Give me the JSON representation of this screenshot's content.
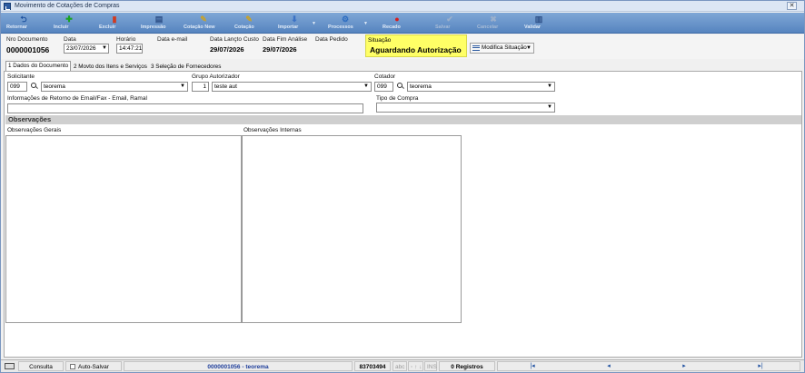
{
  "window": {
    "title": "Movimento de Cotações de Compras",
    "close_label": "✕"
  },
  "toolbar": {
    "buttons": [
      {
        "label": "Retornar",
        "icon": "return-icon",
        "glyph": "⮌",
        "color": "#1b4f9c"
      },
      {
        "label": "Incluir",
        "icon": "plus-icon",
        "glyph": "✚",
        "color": "#1aa321"
      },
      {
        "label": "Excluir",
        "icon": "delete-icon",
        "glyph": "▮",
        "color": "#d13a1f"
      },
      {
        "label": "Impressão",
        "icon": "printer-icon",
        "glyph": "▤",
        "color": "#2d4f86"
      },
      {
        "label": "Cotação New",
        "icon": "quote-new-icon",
        "glyph": "✎",
        "color": "#c9a227"
      },
      {
        "label": "Cotação",
        "icon": "quote-icon",
        "glyph": "✎",
        "color": "#c9a227"
      },
      {
        "label": "Importar",
        "icon": "import-icon",
        "glyph": "⬇",
        "color": "#3c72c4"
      },
      {
        "label": "Processos",
        "icon": "process-icon",
        "glyph": "⚙",
        "color": "#2a6bc0"
      },
      {
        "label": "Recado",
        "icon": "message-icon",
        "glyph": "●",
        "color": "#d62020"
      },
      {
        "label": "Salvar",
        "icon": "save-icon",
        "glyph": "✔",
        "color": "#9bb0cc"
      },
      {
        "label": "Cancelar",
        "icon": "cancel-icon",
        "glyph": "✖",
        "color": "#9bb0cc"
      },
      {
        "label": "Validar",
        "icon": "validate-icon",
        "glyph": "▥",
        "color": "#2d4f86"
      }
    ]
  },
  "header": {
    "nro_documento": {
      "label": "Nro Documento",
      "value": "0000001056"
    },
    "data": {
      "label": "Data",
      "value": "23/07/2026"
    },
    "horario": {
      "label": "Horário",
      "value": "14:47:21"
    },
    "data_email": {
      "label": "Data e-mail"
    },
    "data_lancto_custo": {
      "label": "Data Lançto Custo",
      "value": "29/07/2026"
    },
    "data_fim_analise": {
      "label": "Data Fim Análise",
      "value": "29/07/2026"
    },
    "data_pedido": {
      "label": "Data Pedido"
    },
    "situacao": {
      "label": "Situação",
      "value": "Aguardando Autorização"
    },
    "modifica_situacao": "Modifica Situação"
  },
  "tabs": [
    {
      "label": "1 Dados do Documento",
      "active": true
    },
    {
      "label": "2 Movto dos Itens e Serviços",
      "active": false
    },
    {
      "label": "3 Seleção de Fornecedores",
      "active": false
    }
  ],
  "form": {
    "solicitante": {
      "label": "Solicitante",
      "code": "099",
      "name": "teorema"
    },
    "grupo_autorizador": {
      "label": "Grupo Autorizador",
      "code": "1",
      "name": "teste aut"
    },
    "cotador": {
      "label": "Cotador",
      "code": "099",
      "name": "teorema"
    },
    "info_retorno": {
      "label": "Informações de Retorno de Email/Fax - Email, Ramal",
      "value": ""
    },
    "tipo_compra": {
      "label": "Tipo de Compra",
      "value": ""
    },
    "observacoes": {
      "title": "Observações",
      "gerais_label": "Observações Gerais",
      "internas_label": "Observações Internas"
    }
  },
  "statusbar": {
    "mode": "Consulta",
    "auto_salvar": "Auto-Salvar",
    "record": "0000001056 - teorema",
    "code": "83703494",
    "abc": "abc",
    "cursor": "◦ ↑ ↓",
    "ins": "INS",
    "registros": "0 Registros",
    "nav": {
      "first": "|◂",
      "prev": "◂",
      "next": "▸",
      "last": "▸|"
    }
  }
}
